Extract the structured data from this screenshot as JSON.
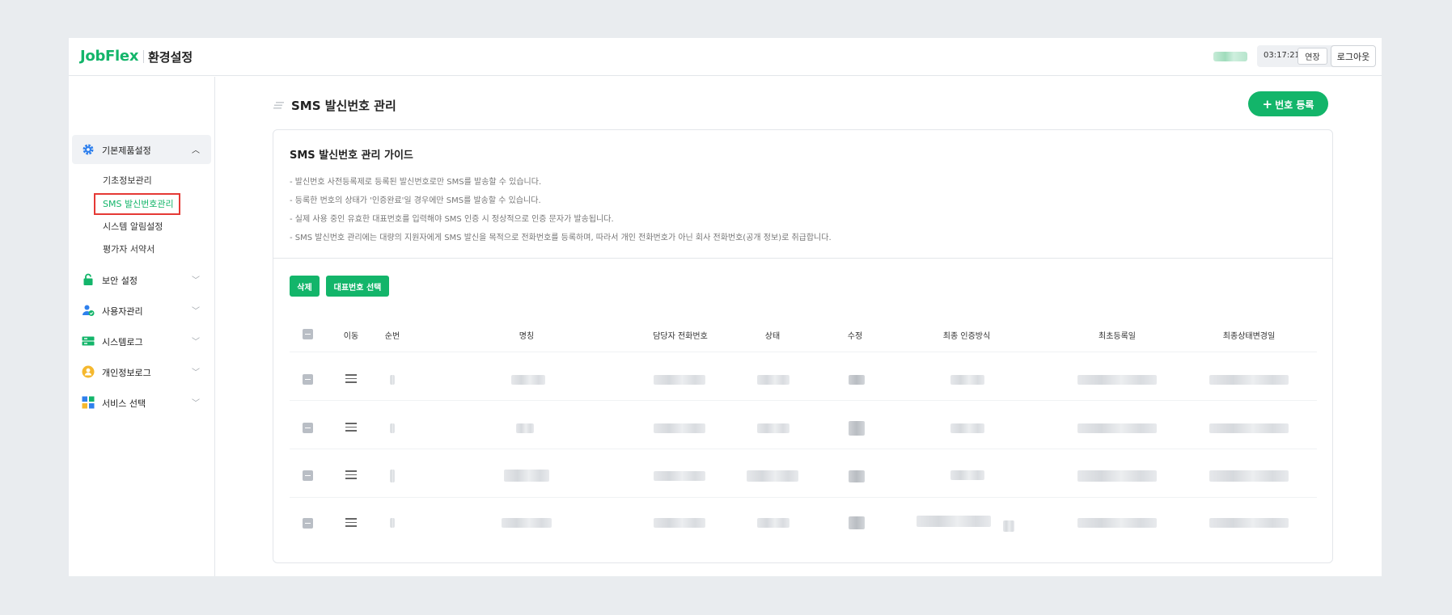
{
  "header": {
    "logo": "JobFlex",
    "title": "환경설정",
    "timer": "03:17:21",
    "extend_label": "연장",
    "logout_label": "로그아웃"
  },
  "sidebar": {
    "groups": [
      {
        "label": "기본제품설정",
        "icon": "gear-icon",
        "expanded": true,
        "items": [
          "기초정보관리",
          "SMS 발신번호관리",
          "시스템 알림설정",
          "평가자 서약서"
        ],
        "active_item": "SMS 발신번호관리"
      },
      {
        "label": "보안 설정",
        "icon": "lock-icon"
      },
      {
        "label": "사용자관리",
        "icon": "user-check-icon"
      },
      {
        "label": "시스템로그",
        "icon": "server-icon"
      },
      {
        "label": "개인정보로그",
        "icon": "person-circle-icon"
      },
      {
        "label": "서비스 선택",
        "icon": "grid-icon"
      }
    ]
  },
  "main": {
    "page_title": "SMS 발신번호 관리",
    "register_label": "번호 등록",
    "guide": {
      "title": "SMS 발신번호 관리 가이드",
      "lines": [
        "-  발신번호 사전등록제로 등록된 발신번호로만 SMS를 발송할 수 있습니다.",
        "-  등록한 번호의 상태가 '인증완료'일 경우에만 SMS를 발송할 수 있습니다.",
        "-  실제 사용 중인 유효한 대표번호를 입력해야 SMS 인증 시 정상적으로 인증 문자가 발송됩니다.",
        "-  SMS 발신번호 관리에는 대량의 지원자에게 SMS 발신을 목적으로 전화번호를 등록하며, 따라서 개인 전화번호가 아닌 회사 전화번호(공개 정보)로 취급합니다."
      ]
    },
    "actions": {
      "delete_label": "삭제",
      "representative_label": "대표번호 선택"
    },
    "table": {
      "columns": [
        "이동",
        "순번",
        "명칭",
        "담당자 전화번호",
        "상태",
        "수정",
        "최종 인증방식",
        "최초등록일",
        "최종상태변경일"
      ],
      "row_count": 4
    }
  },
  "colors": {
    "brand": "#13b56a",
    "highlight": "#e53935"
  }
}
